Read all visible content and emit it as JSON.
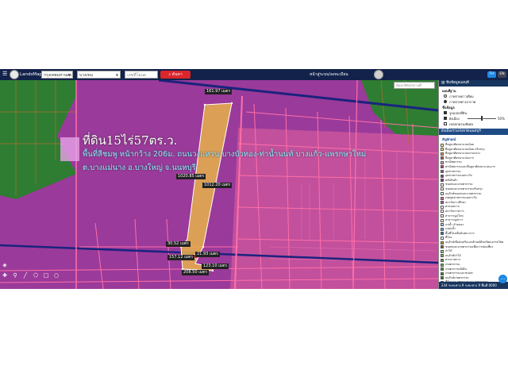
{
  "header": {
    "brand": "LandsMaps",
    "province_select": "กรุงเทพมหานคร",
    "district_select": "บางเขน",
    "parcel_select": "Bang Bua Thong",
    "parcel_number_placeholder": "เลขที่โฉนด",
    "search_button": "ค้นหา",
    "user_text": "หน้าสู่ระบบ/ลงทะเบียน",
    "lang_th": "TH",
    "lang_en": "EN"
  },
  "map": {
    "title_line1": "ที่ดิน15ไร่57ตร.ว.",
    "title_line2": "พื้นที่สีชมพู หน้ากว้าง 206ม. ถนนวงแหวน บางบัวทอง-ท่าน้ำนนท์ บางแก้ว-แพรกษาใหม่",
    "title_line3": "ต.บางแม่นาง อ.บางใหญ่ จ.นนทบุรี",
    "measure_labels": [
      {
        "text": "161.97 เมตร"
      },
      {
        "text": "1020.85 เมตร"
      },
      {
        "text": "1012.20 เมตร"
      },
      {
        "text": "30.52 เมตร"
      },
      {
        "text": "21.93 เมตร"
      },
      {
        "text": "157.12 เมตร"
      },
      {
        "text": "123.10 เมตร"
      },
      {
        "text": "208.50 เมตร"
      }
    ],
    "search_placeholder": "ค้นหาพิกัด/สถานที่"
  },
  "panel": {
    "header": "ชั้นข้อมูลแผนที่",
    "basemap_title": "แผนที่ฐาน",
    "basemap_options": [
      {
        "label": "ภาพถ่ายดาวเทียม",
        "selected": false
      },
      {
        "label": "ภาพถ่ายทางอากาศ",
        "selected": true
      }
    ],
    "layer_title": "ชั้นข้อมูล",
    "layers": [
      {
        "label": "รูปแปลงที่ดิน",
        "checked": true,
        "opacity": "50%"
      },
      {
        "label": "ผังเมือง",
        "checked": true,
        "opacity": "50%"
      },
      {
        "label": "เขตปกครองพิเศษ",
        "checked": false,
        "opacity": ""
      }
    ],
    "section_header": "ผังเมืองรวมจังหวัดนนทบุรี",
    "legend_title": "สัญลักษณ์",
    "legend": [
      {
        "color": "#fff2a8",
        "label": "ที่อยู่อาศัยหนาแน่นน้อย"
      },
      {
        "color": "#f7e26a",
        "label": "ที่อยู่อาศัยหนาแน่นน้อย ปรับปรุง"
      },
      {
        "color": "#e7a03a",
        "label": "ที่อยู่อาศัยหนาแน่นปานกลาง"
      },
      {
        "color": "#c0504d",
        "label": "ที่อยู่อาศัยหนาแน่นมาก"
      },
      {
        "color": "#f2a2c0",
        "label": "พาณิชยกรรม"
      },
      {
        "color": "#d33b8c",
        "label": "พาณิชยกรรมและที่อยู่อาศัยหนาแน่นมาก"
      },
      {
        "color": "#b04aa8",
        "label": "อุตสาหกรรม"
      },
      {
        "color": "#9a3a9a",
        "label": "อุตสาหกรรมเฉพาะกิจ"
      },
      {
        "color": "#7a2e7a",
        "label": "คลังสินค้า"
      },
      {
        "color": "#ffffff",
        "label": "ชนบทและเกษตรกรรม"
      },
      {
        "color": "#ffffff",
        "label": "ชนบทและเกษตรกรรมปรับปรุง"
      },
      {
        "color": "#ffffff",
        "label": "อนุรักษ์ชนบทและเกษตรกรรม"
      },
      {
        "color": "#e060a0",
        "label": "เขตอุตสาหกรรมเฉพาะกิจ"
      },
      {
        "color": "#c040c0",
        "label": "สถาบันการศึกษา"
      },
      {
        "color": "#ffffff",
        "label": "ศาสนสถาน"
      },
      {
        "color": "#ffffff",
        "label": "สถาบันราชการ"
      },
      {
        "color": "#ffffff",
        "label": "สาธารณูปโภค"
      },
      {
        "color": "#ffffff",
        "label": "สาธารณูปการ"
      },
      {
        "color": "#a8c8e8",
        "label": "แม่น้ำ ลำคลอง"
      },
      {
        "color": "#5aa0d8",
        "label": "แหล่งน้ำ"
      },
      {
        "color": "#2f6fb0",
        "label": "พื้นที่โล่งเพื่อนันทนาการ"
      },
      {
        "color": "#ffffff",
        "label": "ที่โล่ง"
      },
      {
        "color": "#c7a020",
        "label": "อนุรักษ์เพื่อส่งเสริมเอกลักษณ์ศิลปวัฒนธรรมไทย"
      },
      {
        "color": "#8b5a2b",
        "label": "ชนบทและเกษตรกรรมเพื่อการท่องเที่ยว"
      },
      {
        "color": "#a0d070",
        "label": "ป่าไม้"
      },
      {
        "color": "#7ab648",
        "label": "อนุรักษ์ป่าไม้"
      },
      {
        "color": "#58a030",
        "label": "ส่วนราชการ"
      },
      {
        "color": "#6ab04c",
        "label": "เกษตรกรรม"
      },
      {
        "color": "#4c9a2a",
        "label": "เกษตรกรรมยั่งยืน"
      },
      {
        "color": "#3e8a22",
        "label": "เกษตรกรรมและชนบท"
      },
      {
        "color": "#2e7a18",
        "label": "อนุรักษ์เกษตรกรรม"
      },
      {
        "color": "#a4c639",
        "label": "ที่ดินประเภทชนบทและเกษตรกรรม"
      },
      {
        "color": "#8fb02a",
        "label": "ที่ดินประเภทอนุรักษ์"
      },
      {
        "color": "#e8a040",
        "label": "ที่ดินประเภทพาณิชยกรรม"
      },
      {
        "color": "#d07030",
        "label": "ที่ดินประเภทอุตสาหกรรม"
      },
      {
        "color": "#ffffff",
        "label": "ที่ดินประเภทอื่นๆ"
      },
      {
        "color": "#c04020",
        "label": "ที่ดินประเภทสถาบัน"
      },
      {
        "color": "#b03020",
        "label": "ที่ดินประเภทศาสนา"
      },
      {
        "color": "#f0d060",
        "label": "พื้นที่พัฒนาพิเศษ"
      },
      {
        "color": "#ffffff",
        "label": "พื้นที่ส่งเสริม"
      }
    ],
    "footer": "234 ระยะทาง 9 ระยะทาง 9 พื้นที่ 0000"
  },
  "fab_label": "..."
}
